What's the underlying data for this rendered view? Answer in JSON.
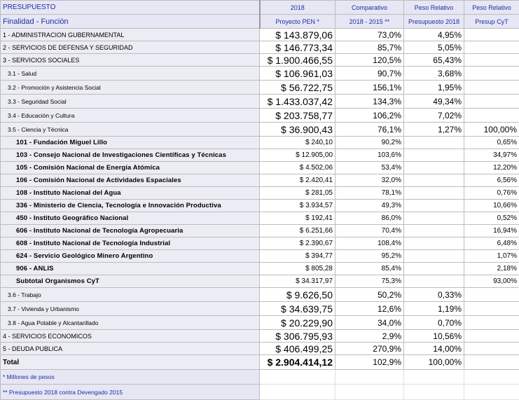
{
  "header": {
    "title": "PRESUPUESTO",
    "col_amount_year": "2018",
    "col_comp": "Comparativo",
    "col_peso": "Peso Relativo",
    "col_peso_cyt": "Peso Relativo",
    "subtitle": "Finalidad - Función",
    "col_amount_sub": "Proyecto PEN *",
    "col_comp_sub": "2018 - 2015 **",
    "col_peso_sub": "Presupuesto 2018",
    "col_peso_cyt_sub": "Presup CyT"
  },
  "rows": [
    {
      "name": "1 - ADMINISTRACION GUBERNAMENTAL",
      "amount": "$ 143.879,06",
      "comp": "73,0%",
      "peso": "4,95%",
      "peso_cyt": ""
    },
    {
      "name": "2 - SERVICIOS DE DEFENSA Y SEGURIDAD",
      "amount": "$ 146.773,34",
      "comp": "85,7%",
      "peso": "5,05%",
      "peso_cyt": ""
    },
    {
      "name": "3 - SERVICIOS SOCIALES",
      "amount": "$ 1.900.466,55",
      "comp": "120,5%",
      "peso": "65,43%",
      "peso_cyt": ""
    },
    {
      "name": "3.1 - Salud",
      "amount": "$ 106.961,03",
      "comp": "90,7%",
      "peso": "3,68%",
      "peso_cyt": ""
    },
    {
      "name": "3.2 - Promoción y Asistencia Social",
      "amount": "$ 56.722,75",
      "comp": "156,1%",
      "peso": "1,95%",
      "peso_cyt": ""
    },
    {
      "name": "3.3 - Seguridad Social",
      "amount": "$ 1.433.037,42",
      "comp": "134,3%",
      "peso": "49,34%",
      "peso_cyt": ""
    },
    {
      "name": "3.4 - Educación y Cultura",
      "amount": "$ 203.758,77",
      "comp": "106,2%",
      "peso": "7,02%",
      "peso_cyt": ""
    },
    {
      "name": "3.5 - Ciencia y Técnica",
      "amount": "$ 36.900,43",
      "comp": "76,1%",
      "peso": "1,27%",
      "peso_cyt": "100,00%"
    },
    {
      "name": "101 - Fundación Miguel Lillo",
      "amount": "$ 240,10",
      "comp": "90,2%",
      "peso": "",
      "peso_cyt": "0,65%"
    },
    {
      "name": "103 - Consejo Nacional de Investigaciones Científicas y Técnicas",
      "amount": "$ 12.905,00",
      "comp": "103,6%",
      "peso": "",
      "peso_cyt": "34,97%"
    },
    {
      "name": "105 - Comisión Nacional de Energía Atómica",
      "amount": "$ 4.502,06",
      "comp": "53,4%",
      "peso": "",
      "peso_cyt": "12,20%"
    },
    {
      "name": "106 - Comisión Nacional de Actividades Espaciales",
      "amount": "$ 2.420,41",
      "comp": "32,0%",
      "peso": "",
      "peso_cyt": "6,56%"
    },
    {
      "name": "108 - Instituto Nacional del Agua",
      "amount": "$ 281,05",
      "comp": "78,1%",
      "peso": "",
      "peso_cyt": "0,76%"
    },
    {
      "name": "336 - Ministerio de Ciencia, Tecnología e Innovación Productiva",
      "amount": "$ 3.934,57",
      "comp": "49,3%",
      "peso": "",
      "peso_cyt": "10,66%"
    },
    {
      "name": "450 - Instituto Geográfico Nacional",
      "amount": "$ 192,41",
      "comp": "86,0%",
      "peso": "",
      "peso_cyt": "0,52%"
    },
    {
      "name": "606 - Instituto Nacional de Tecnología Agropecuaria",
      "amount": "$ 6.251,66",
      "comp": "70,4%",
      "peso": "",
      "peso_cyt": "16,94%"
    },
    {
      "name": "608 - Instituto Nacional de Tecnología Industrial",
      "amount": "$ 2.390,67",
      "comp": "108,4%",
      "peso": "",
      "peso_cyt": "6,48%"
    },
    {
      "name": "624 - Servicio Geológico Minero Argentino",
      "amount": "$ 394,77",
      "comp": "95,2%",
      "peso": "",
      "peso_cyt": "1,07%"
    },
    {
      "name": "906 - ANLIS",
      "amount": "$ 805,28",
      "comp": "85,4%",
      "peso": "",
      "peso_cyt": "2,18%"
    },
    {
      "name": "Subtotal Organismos CyT",
      "amount": "$ 34.317,97",
      "comp": "75,3%",
      "peso": "",
      "peso_cyt": "93,00%"
    },
    {
      "name": "3.6 - Trabajo",
      "amount": "$ 9.626,50",
      "comp": "50,2%",
      "peso": "0,33%",
      "peso_cyt": ""
    },
    {
      "name": "3.7 - Vivienda y Urbanismo",
      "amount": "$ 34.639,75",
      "comp": "12,6%",
      "peso": "1,19%",
      "peso_cyt": ""
    },
    {
      "name": "3.8 - Agua Potable y Alcantarillado",
      "amount": "$ 20.229,90",
      "comp": "34,0%",
      "peso": "0,70%",
      "peso_cyt": ""
    },
    {
      "name": "4 - SERVICIOS ECONOMICOS",
      "amount": "$ 306.795,93",
      "comp": "2,9%",
      "peso": "10,56%",
      "peso_cyt": ""
    },
    {
      "name": "5 - DEUDA PUBLICA",
      "amount": "$ 406.499,25",
      "comp": "270,9%",
      "peso": "14,00%",
      "peso_cyt": ""
    },
    {
      "name": "Total",
      "amount": "$ 2.904.414,12",
      "comp": "102,9%",
      "peso": "100,00%",
      "peso_cyt": ""
    }
  ],
  "footnotes": {
    "note1": "* Millones de pesos",
    "note2": "** Presupuesto 2018 contra Devengado 2015"
  }
}
